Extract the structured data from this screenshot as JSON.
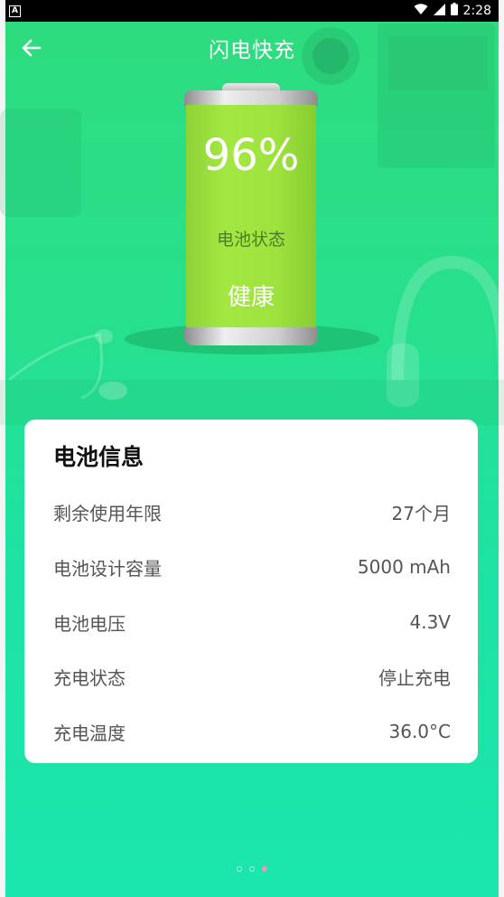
{
  "status_bar": {
    "left_badge": "A",
    "time": "2:28"
  },
  "header": {
    "title": "闪电快充"
  },
  "battery": {
    "percent": "96%",
    "level": 0.96,
    "status_label": "电池状态",
    "health": "健康"
  },
  "info_card": {
    "title": "电池信息",
    "rows": [
      {
        "label": "剩余使用年限",
        "value": "27个月"
      },
      {
        "label": "电池设计容量",
        "value": "5000 mAh"
      },
      {
        "label": "电池电压",
        "value": "4.3V"
      },
      {
        "label": "充电状态",
        "value": "停止充电"
      },
      {
        "label": "充电温度",
        "value": "36.0°C"
      }
    ]
  },
  "pager": {
    "count": 3,
    "active_index": 2
  },
  "colors": {
    "background_top": "#2fdc7e",
    "background_bottom": "#1be6ad",
    "battery_fill": "#9ee23e",
    "pager_active": "#ff8fb8"
  },
  "icons": {
    "back": "arrow-left-icon",
    "wifi": "wifi-icon",
    "signal": "signal-icon",
    "battery_status": "battery-icon"
  }
}
